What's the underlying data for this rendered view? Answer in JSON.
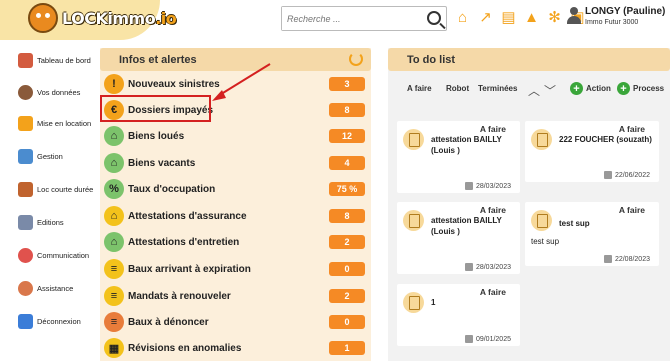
{
  "header": {
    "logo_text": "LOCKimmo",
    "logo_suffix": ".io",
    "search_placeholder": "Recherche ...",
    "user_name": "LONGY (Pauline)",
    "user_org": "Immo Futur 3000",
    "accent": "#f3a21b"
  },
  "sidebar": {
    "items": [
      {
        "label": "Tableau de bord",
        "icon": "dashboard-icon",
        "color": "#d35b3f"
      },
      {
        "label": "Vos données",
        "icon": "person-icon",
        "color": "#8a5a3a"
      },
      {
        "label": "Mise en location",
        "icon": "keys-icon",
        "color": "#f3a21b"
      },
      {
        "label": "Gestion",
        "icon": "gestion-icon",
        "color": "#4b8ccf"
      },
      {
        "label": "Loc courte durée",
        "icon": "suitcase-icon",
        "color": "#c0632e"
      },
      {
        "label": "Editions",
        "icon": "documents-icon",
        "color": "#7a8aa8"
      },
      {
        "label": "Communication",
        "icon": "chat-icon",
        "color": "#e0524d"
      },
      {
        "label": "Assistance",
        "icon": "support-icon",
        "color": "#d9774b"
      },
      {
        "label": "Déconnexion",
        "icon": "logout-icon",
        "color": "#3b7dd8"
      }
    ]
  },
  "infos": {
    "title": "Infos et alertes",
    "alerts": [
      {
        "label": "Nouveaux sinistres",
        "count": "3",
        "icon": "warning-icon",
        "icon_color": "#f3a21b",
        "glyph": "!"
      },
      {
        "label": "Dossiers impayés",
        "count": "8",
        "icon": "unpaid-icon",
        "icon_color": "#f3a21b",
        "glyph": "€"
      },
      {
        "label": "Biens loués",
        "count": "12",
        "icon": "rented-house-icon",
        "icon_color": "#7cc36b",
        "glyph": "⌂"
      },
      {
        "label": "Biens vacants",
        "count": "4",
        "icon": "vacant-house-icon",
        "icon_color": "#7cc36b",
        "glyph": "⌂"
      },
      {
        "label": "Taux d'occupation",
        "count": "75 %",
        "icon": "occupancy-icon",
        "icon_color": "#7cc36b",
        "glyph": "%"
      },
      {
        "label": "Attestations d'assurance",
        "count": "8",
        "icon": "insurance-house-icon",
        "icon_color": "#f3c21b",
        "glyph": "⌂"
      },
      {
        "label": "Attestations d'entretien",
        "count": "2",
        "icon": "maintenance-house-icon",
        "icon_color": "#7cc36b",
        "glyph": "⌂"
      },
      {
        "label": "Baux arrivant à expiration",
        "count": "0",
        "icon": "lease-expiry-icon",
        "icon_color": "#f3c21b",
        "glyph": "≡"
      },
      {
        "label": "Mandats à renouveler",
        "count": "2",
        "icon": "mandate-icon",
        "icon_color": "#f3c21b",
        "glyph": "≡"
      },
      {
        "label": "Baux à dénoncer",
        "count": "0",
        "icon": "lease-terminate-icon",
        "icon_color": "#e87c3a",
        "glyph": "≡"
      },
      {
        "label": "Révisions en anomalies",
        "count": "1",
        "icon": "revision-icon",
        "icon_color": "#f3c21b",
        "glyph": "▦"
      }
    ]
  },
  "todo": {
    "title": "To do list",
    "tabs": [
      "A faire",
      "Robot",
      "Terminées"
    ],
    "action_label": "Action",
    "process_label": "Process",
    "cards": [
      {
        "status": "A faire",
        "title": "attestation BAILLY (Louis )",
        "sub": "",
        "date": "28/03/2023"
      },
      {
        "status": "A faire",
        "title": "222 FOUCHER (souzath)",
        "sub": "",
        "date": "22/06/2022"
      },
      {
        "status": "A faire",
        "title": "attestation BAILLY (Louis )",
        "sub": "",
        "date": "28/03/2023"
      },
      {
        "status": "A faire",
        "title": "test sup",
        "sub": "test sup",
        "date": "22/08/2023"
      },
      {
        "status": "A faire",
        "title": "1",
        "sub": "",
        "date": "09/01/2025"
      }
    ]
  }
}
